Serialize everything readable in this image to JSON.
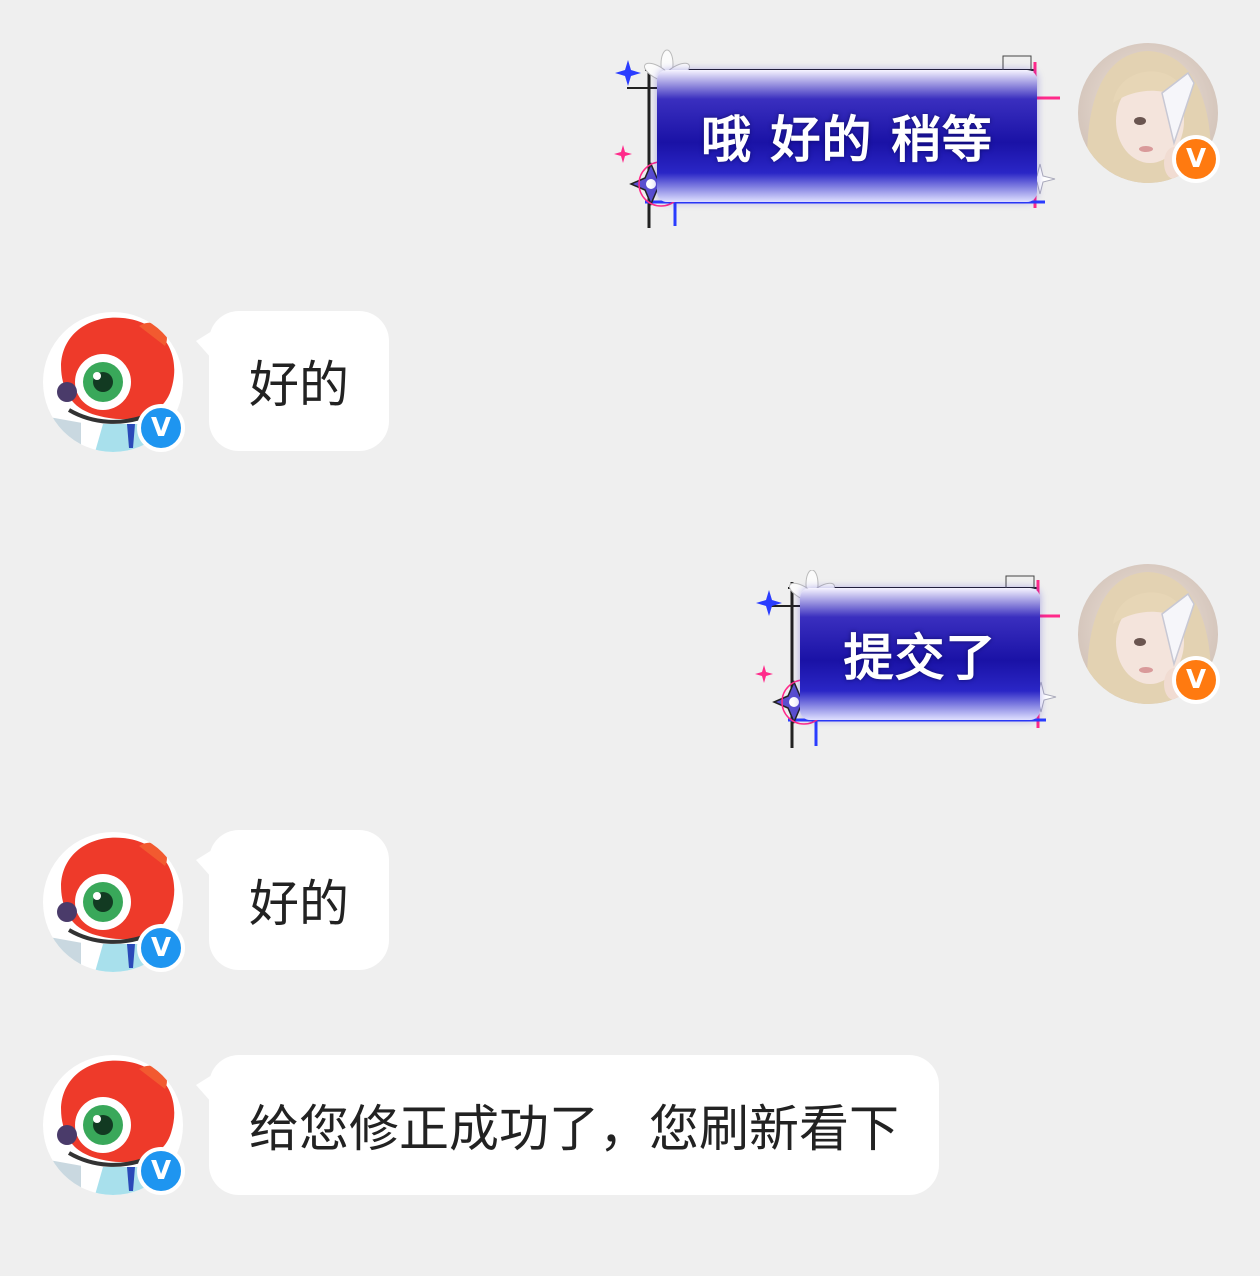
{
  "conversation": {
    "messages": [
      {
        "sender": "me",
        "text": "哦 好的 稍等",
        "badge": "V"
      },
      {
        "sender": "service",
        "text": "好的",
        "badge": "V"
      },
      {
        "sender": "me",
        "text": "提交了",
        "badge": "V"
      },
      {
        "sender": "service",
        "text": "好的",
        "badge": "V"
      },
      {
        "sender": "service",
        "text": "给您修正成功了，您刷新看下",
        "badge": "V"
      }
    ]
  },
  "colors": {
    "background": "#efefef",
    "incoming_bubble": "#ffffff",
    "incoming_text": "#222222",
    "outgoing_bubble": "#1a12a6",
    "outgoing_text": "#ffffff",
    "verified_badge_blue": "#1e95f0",
    "verified_badge_orange": "#ff7a10",
    "frame_pink": "#ff2a8a",
    "frame_blue": "#2a3cff"
  },
  "icons": {
    "service_avatar": "red-eye-mascot-avatar",
    "user_avatar": "user-photo-avatar",
    "verified_badge": "verified-v-badge",
    "bubble_decoration": "lily-sparkle-frame"
  }
}
